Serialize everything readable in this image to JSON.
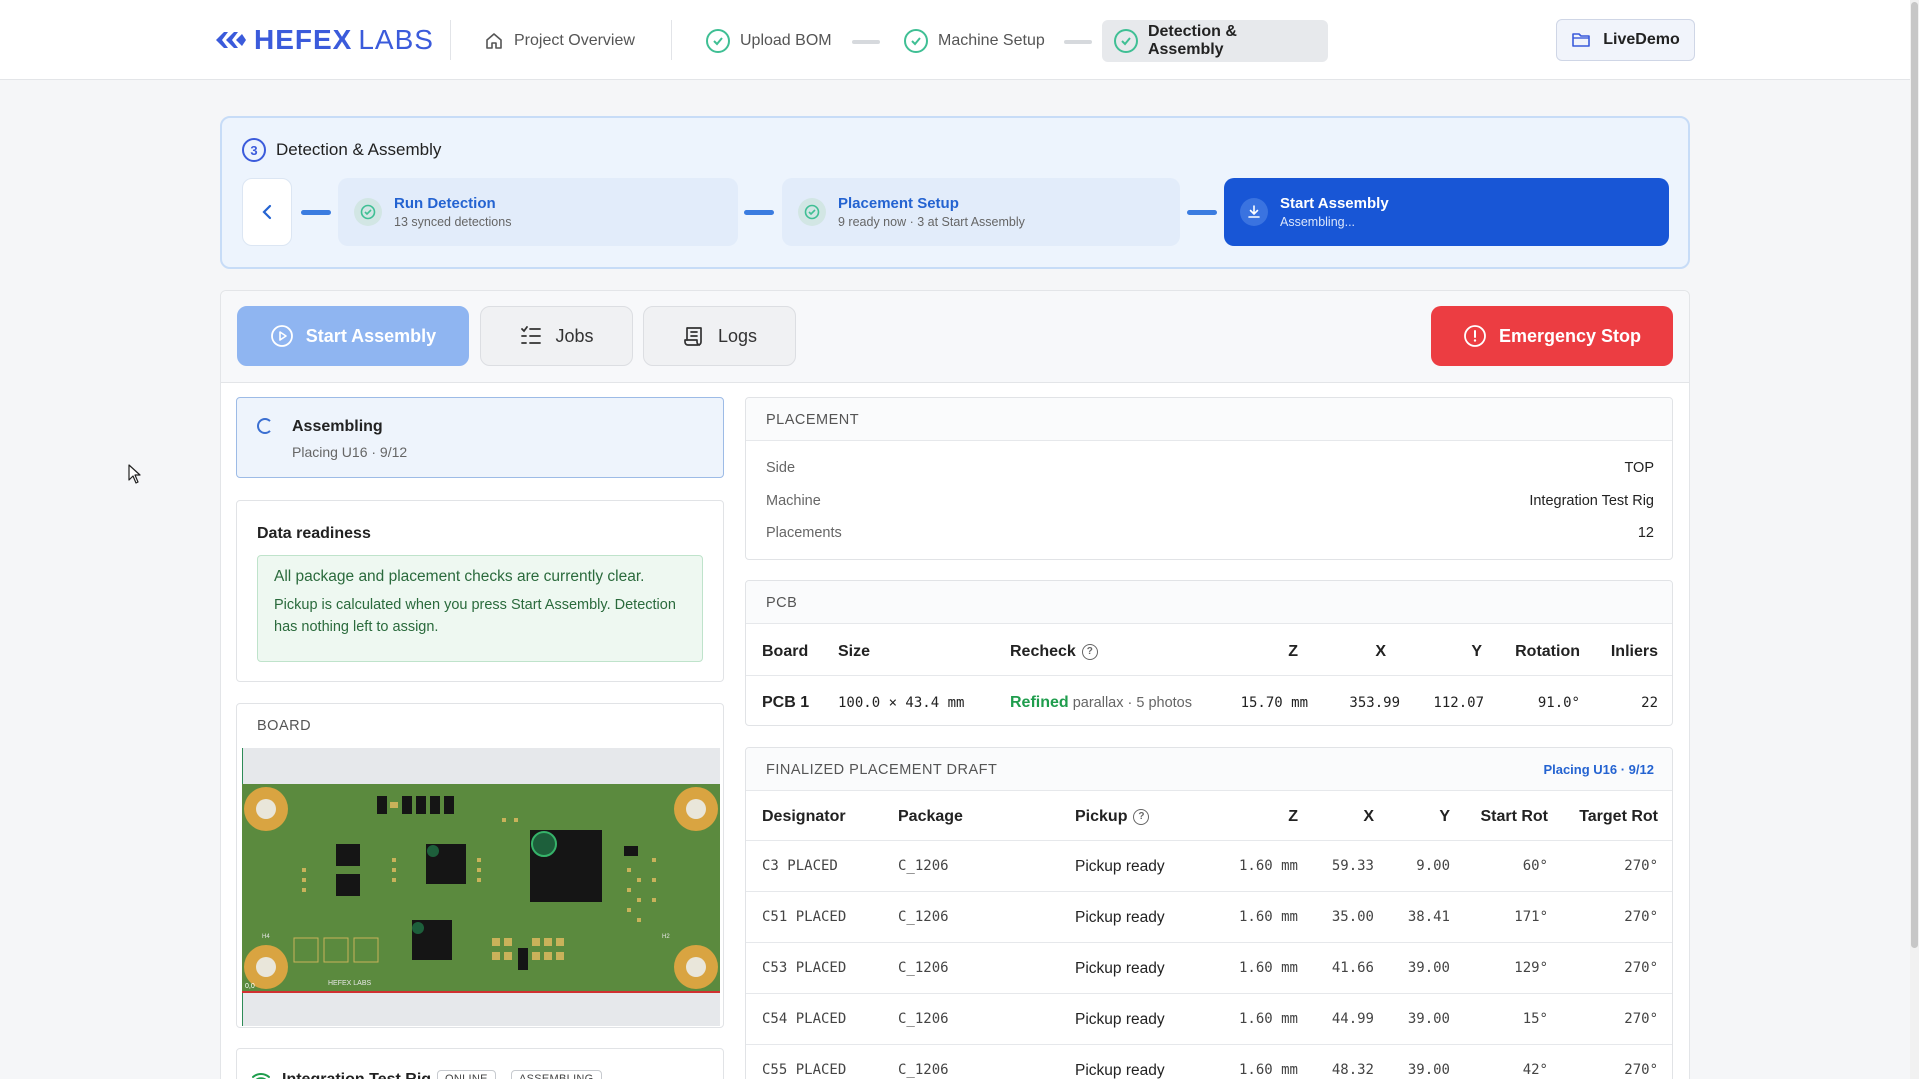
{
  "brand": {
    "word1": "HEFEX",
    "word2": "LABS"
  },
  "nav": {
    "project_overview": "Project Overview",
    "upload_bom": "Upload BOM",
    "machine_setup": "Machine Setup",
    "detection_assembly": "Detection & Assembly",
    "live_demo": "LiveDemo"
  },
  "stepper": {
    "number": "3",
    "title": "Detection & Assembly",
    "steps": [
      {
        "title": "Run Detection",
        "sub": "13 synced detections"
      },
      {
        "title": "Placement Setup",
        "sub": "9 ready now · 3 at Start Assembly"
      },
      {
        "title": "Start Assembly",
        "sub": "Assembling..."
      }
    ]
  },
  "tabs": {
    "start": "Start Assembly",
    "jobs": "Jobs",
    "logs": "Logs",
    "estop": "Emergency Stop"
  },
  "status": {
    "title": "Assembling",
    "sub": "Placing U16 · 9/12"
  },
  "readiness": {
    "title": "Data readiness",
    "line1": "All package and placement checks are currently clear.",
    "line2": "Pickup is calculated when you press Start Assembly. Detection has nothing left to assign."
  },
  "board": {
    "title": "BOARD",
    "silkscreen": "HEFEX LABS",
    "h1": "H4",
    "h2": "H2",
    "origin": "0,0"
  },
  "robot": {
    "name": "Integration Test Rig",
    "badge1": "ONLINE",
    "badge2": "ASSEMBLING"
  },
  "placement": {
    "title": "PLACEMENT",
    "rows": [
      {
        "k": "Side",
        "v": "TOP"
      },
      {
        "k": "Machine",
        "v": "Integration Test Rig"
      },
      {
        "k": "Placements",
        "v": "12"
      }
    ]
  },
  "pcb": {
    "title": "PCB",
    "headers": {
      "board": "Board",
      "size": "Size",
      "recheck": "Recheck",
      "z": "Z",
      "x": "X",
      "y": "Y",
      "rotation": "Rotation",
      "inliers": "Inliers"
    },
    "row": {
      "board": "PCB 1",
      "size": "100.0 × 43.4 mm",
      "recheck_status": "Refined",
      "recheck_detail": "parallax · 5 photos",
      "z": "15.70 mm",
      "x": "353.99",
      "y": "112.07",
      "rotation": "91.0°",
      "inliers": "22"
    }
  },
  "draft": {
    "title": "FINALIZED PLACEMENT DRAFT",
    "status": "Placing U16 · 9/12",
    "headers": {
      "designator": "Designator",
      "package": "Package",
      "pickup": "Pickup",
      "z": "Z",
      "x": "X",
      "y": "Y",
      "start_rot": "Start Rot",
      "target_rot": "Target Rot"
    },
    "rows": [
      {
        "designator": "C3 PLACED",
        "package": "C_1206",
        "pickup": "Pickup ready",
        "z": "1.60 mm",
        "x": "59.33",
        "y": "9.00",
        "start_rot": "60°",
        "target_rot": "270°"
      },
      {
        "designator": "C51 PLACED",
        "package": "C_1206",
        "pickup": "Pickup ready",
        "z": "1.60 mm",
        "x": "35.00",
        "y": "38.41",
        "start_rot": "171°",
        "target_rot": "270°"
      },
      {
        "designator": "C53 PLACED",
        "package": "C_1206",
        "pickup": "Pickup ready",
        "z": "1.60 mm",
        "x": "41.66",
        "y": "39.00",
        "start_rot": "129°",
        "target_rot": "270°"
      },
      {
        "designator": "C54 PLACED",
        "package": "C_1206",
        "pickup": "Pickup ready",
        "z": "1.60 mm",
        "x": "44.99",
        "y": "39.00",
        "start_rot": "15°",
        "target_rot": "270°"
      },
      {
        "designator": "C55 PLACED",
        "package": "C_1206",
        "pickup": "Pickup ready",
        "z": "1.60 mm",
        "x": "48.32",
        "y": "39.00",
        "start_rot": "42°",
        "target_rot": "270°"
      }
    ]
  },
  "colors": {
    "accent": "#3b5bdb",
    "active_step": "#1856d6",
    "estop": "#ec3d42",
    "ready": "#1f9d4d"
  }
}
